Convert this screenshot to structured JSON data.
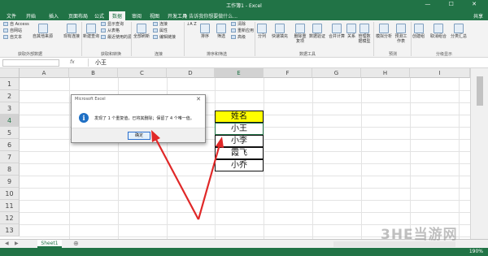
{
  "window": {
    "title": "工作簿1 - Excel",
    "controls": "— ☐ ✕"
  },
  "tabs": [
    "文件",
    "开始",
    "插入",
    "页面布局",
    "公式",
    "数据",
    "审阅",
    "视图",
    "开发工具"
  ],
  "active_tab": "数据",
  "tell_me": "♀ 告诉我你想要做什么...",
  "share": "共享",
  "ribbon": {
    "access": "自 Access",
    "web": "自网站",
    "text": "自文本",
    "other_sources": "自其他来源",
    "existing_conn": "现有连接",
    "new_query": "新建查询",
    "show_query": "显示查询",
    "from_table": "从表格",
    "recent_sources": "最近使用的源",
    "refresh_all": "全部刷新",
    "connections": "连接",
    "properties": "属性",
    "edit_links": "编辑链接",
    "sort_az": "↓A Z",
    "sort": "排序",
    "filter": "筛选",
    "clear": "清除",
    "reapply": "重新应用",
    "advanced": "高级",
    "text_to_columns": "分列",
    "flash_fill": "快速填充",
    "remove_duplicates": "删除重复项",
    "data_validation": "数据验证",
    "consolidate": "合并计算",
    "relationships": "关系",
    "manage_model": "管理数据模型",
    "what_if": "模拟分析",
    "forecast_sheet": "预测工作表",
    "group": "创建组",
    "ungroup": "取消组合",
    "subtotal": "分类汇总",
    "groups": {
      "get_external": "获取外部数据",
      "get_transform": "获取和转换",
      "connections": "连接",
      "sort_filter": "排序和筛选",
      "data_tools": "数据工具",
      "forecast": "预测",
      "outline": "分级显示"
    }
  },
  "formula_bar": {
    "fx": "fx",
    "value": "小王"
  },
  "columns": [
    "A",
    "B",
    "C",
    "D",
    "E",
    "F",
    "G",
    "H",
    "I"
  ],
  "rows": [
    "1",
    "2",
    "3",
    "4",
    "5",
    "6",
    "7",
    "8",
    "9",
    "10",
    "11",
    "12",
    "13"
  ],
  "cells": {
    "E3": "姓名",
    "E4": "小王",
    "E5": "小李",
    "E6": "霞飞",
    "E7": "小乔"
  },
  "dialog": {
    "title": "Microsoft Excel",
    "message": "发现了 1 个重复值，已将其删除；保留了 4 个唯一值。",
    "ok": "确定",
    "close": "✕"
  },
  "sheet_tab": "Sheet1",
  "add_sheet": "⊕",
  "zoom": "190%",
  "watermark": "3HE当游网"
}
